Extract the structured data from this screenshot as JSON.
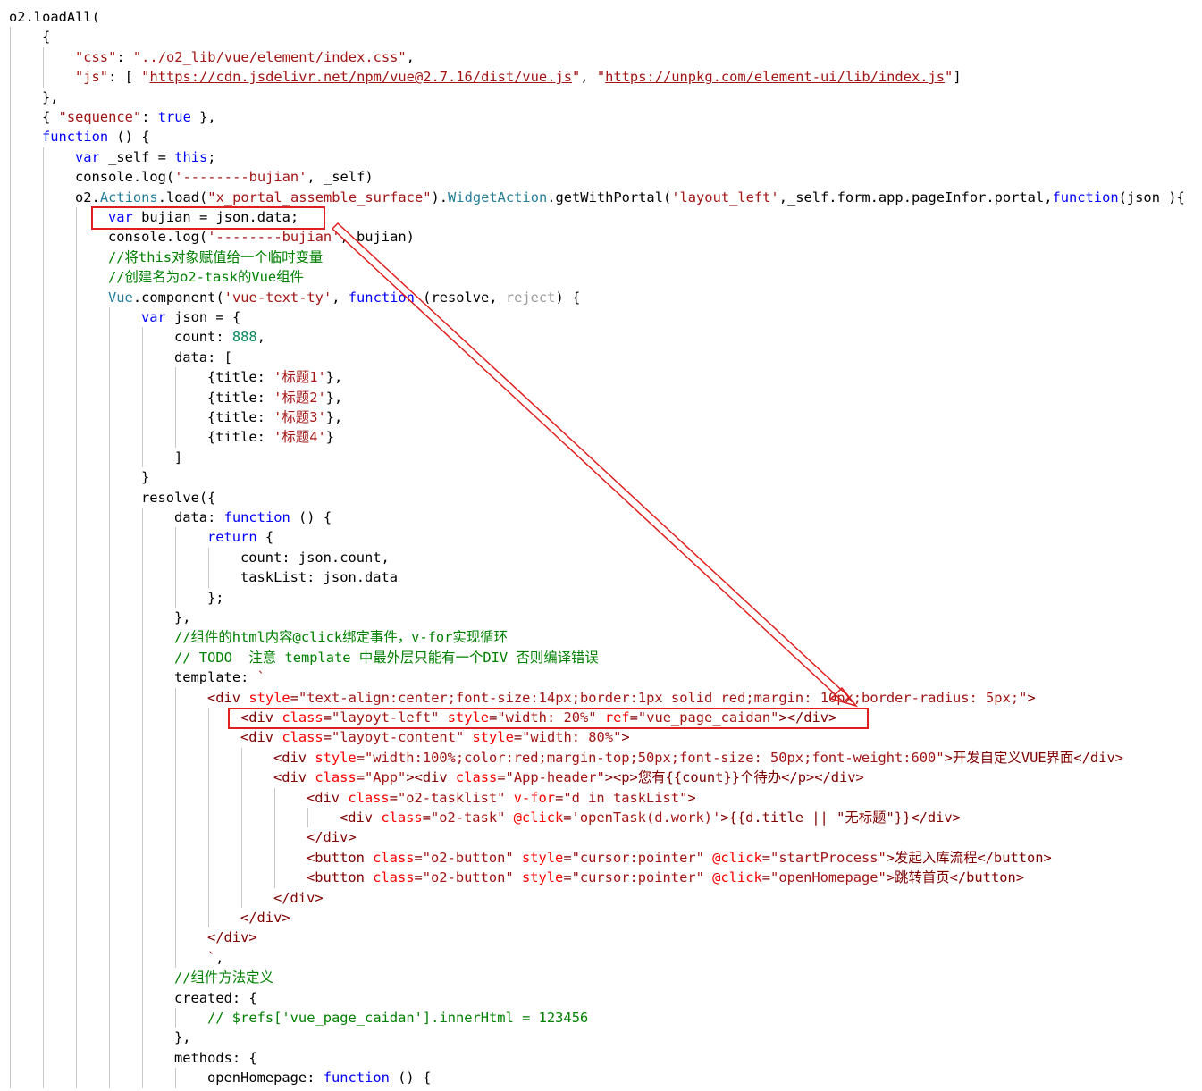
{
  "editor": {
    "lines": [
      {
        "indent": 0,
        "tokens": [
          {
            "c": "t-prop",
            "t": "o2.loadAll("
          }
        ]
      },
      {
        "indent": 1,
        "tokens": [
          {
            "c": "t-prop",
            "t": "{"
          }
        ]
      },
      {
        "indent": 2,
        "tokens": [
          {
            "c": "t-str",
            "t": "\"css\""
          },
          {
            "c": "t-prop",
            "t": ": "
          },
          {
            "c": "t-str",
            "t": "\"../o2_lib/vue/element/index.css\""
          },
          {
            "c": "t-prop",
            "t": ","
          }
        ]
      },
      {
        "indent": 2,
        "tokens": [
          {
            "c": "t-str",
            "t": "\"js\""
          },
          {
            "c": "t-prop",
            "t": ": [ "
          },
          {
            "c": "t-str",
            "t": "\""
          },
          {
            "c": "t-url",
            "t": "https://cdn.jsdelivr.net/npm/vue@2.7.16/dist/vue.js"
          },
          {
            "c": "t-str",
            "t": "\""
          },
          {
            "c": "t-prop",
            "t": ", "
          },
          {
            "c": "t-str",
            "t": "\""
          },
          {
            "c": "t-url",
            "t": "https://unpkg.com/element-ui/lib/index.js"
          },
          {
            "c": "t-str",
            "t": "\""
          },
          {
            "c": "t-prop",
            "t": "]"
          }
        ]
      },
      {
        "indent": 1,
        "tokens": [
          {
            "c": "t-prop",
            "t": "},"
          }
        ]
      },
      {
        "indent": 1,
        "tokens": [
          {
            "c": "t-prop",
            "t": "{ "
          },
          {
            "c": "t-str",
            "t": "\"sequence\""
          },
          {
            "c": "t-prop",
            "t": ": "
          },
          {
            "c": "t-kw",
            "t": "true"
          },
          {
            "c": "t-prop",
            "t": " },"
          }
        ]
      },
      {
        "indent": 1,
        "tokens": [
          {
            "c": "t-kw",
            "t": "function"
          },
          {
            "c": "t-prop",
            "t": " () {"
          }
        ]
      },
      {
        "indent": 2,
        "tokens": [
          {
            "c": "t-kw",
            "t": "var"
          },
          {
            "c": "t-prop",
            "t": " _self = "
          },
          {
            "c": "t-kw",
            "t": "this"
          },
          {
            "c": "t-prop",
            "t": ";"
          }
        ]
      },
      {
        "indent": 2,
        "tokens": [
          {
            "c": "t-prop",
            "t": "console.log("
          },
          {
            "c": "t-str",
            "t": "'--------bujian'"
          },
          {
            "c": "t-prop",
            "t": ", _self)"
          }
        ]
      },
      {
        "indent": 2,
        "tokens": [
          {
            "c": "t-prop",
            "t": "o2."
          },
          {
            "c": "t-obj",
            "t": "Actions"
          },
          {
            "c": "t-prop",
            "t": ".load("
          },
          {
            "c": "t-str",
            "t": "\"x_portal_assemble_surface\""
          },
          {
            "c": "t-prop",
            "t": ")."
          },
          {
            "c": "t-obj",
            "t": "WidgetAction"
          },
          {
            "c": "t-prop",
            "t": ".getWithPortal("
          },
          {
            "c": "t-str",
            "t": "'layout_left'"
          },
          {
            "c": "t-prop",
            "t": ",_self.form.app.pageInfor.portal,"
          },
          {
            "c": "t-kw",
            "t": "function"
          },
          {
            "c": "t-prop",
            "t": "(json ){"
          }
        ]
      },
      {
        "indent": 3,
        "tokens": [
          {
            "c": "t-kw",
            "t": "var"
          },
          {
            "c": "t-prop",
            "t": " bujian = json.data;"
          }
        ]
      },
      {
        "indent": 3,
        "tokens": [
          {
            "c": "t-prop",
            "t": "console.log("
          },
          {
            "c": "t-str",
            "t": "'--------bujian'"
          },
          {
            "c": "t-prop",
            "t": ", bujian)"
          }
        ]
      },
      {
        "indent": 3,
        "tokens": [
          {
            "c": "t-cm",
            "t": "//将this对象赋值给一个临时变量"
          }
        ]
      },
      {
        "indent": 3,
        "tokens": [
          {
            "c": "t-cm",
            "t": "//创建名为o2-task的Vue组件"
          }
        ]
      },
      {
        "indent": 3,
        "tokens": [
          {
            "c": "t-obj",
            "t": "Vue"
          },
          {
            "c": "t-prop",
            "t": ".component("
          },
          {
            "c": "t-str",
            "t": "'vue-text-ty'"
          },
          {
            "c": "t-prop",
            "t": ", "
          },
          {
            "c": "t-kw",
            "t": "function"
          },
          {
            "c": "t-prop",
            "t": " (resolve, "
          },
          {
            "c": "t-param",
            "t": "reject"
          },
          {
            "c": "t-prop",
            "t": ") {"
          }
        ]
      },
      {
        "indent": 4,
        "tokens": [
          {
            "c": "t-kw",
            "t": "var"
          },
          {
            "c": "t-prop",
            "t": " json = {"
          }
        ]
      },
      {
        "indent": 5,
        "tokens": [
          {
            "c": "t-prop",
            "t": "count: "
          },
          {
            "c": "t-num",
            "t": "888"
          },
          {
            "c": "t-prop",
            "t": ","
          }
        ]
      },
      {
        "indent": 5,
        "tokens": [
          {
            "c": "t-prop",
            "t": "data: ["
          }
        ]
      },
      {
        "indent": 6,
        "tokens": [
          {
            "c": "t-prop",
            "t": "{title: "
          },
          {
            "c": "t-str",
            "t": "'标题1'"
          },
          {
            "c": "t-prop",
            "t": "},"
          }
        ]
      },
      {
        "indent": 6,
        "tokens": [
          {
            "c": "t-prop",
            "t": "{title: "
          },
          {
            "c": "t-str",
            "t": "'标题2'"
          },
          {
            "c": "t-prop",
            "t": "},"
          }
        ]
      },
      {
        "indent": 6,
        "tokens": [
          {
            "c": "t-prop",
            "t": "{title: "
          },
          {
            "c": "t-str",
            "t": "'标题3'"
          },
          {
            "c": "t-prop",
            "t": "},"
          }
        ]
      },
      {
        "indent": 6,
        "tokens": [
          {
            "c": "t-prop",
            "t": "{title: "
          },
          {
            "c": "t-str",
            "t": "'标题4'"
          },
          {
            "c": "t-prop",
            "t": "}"
          }
        ]
      },
      {
        "indent": 5,
        "tokens": [
          {
            "c": "t-prop",
            "t": "]"
          }
        ]
      },
      {
        "indent": 4,
        "tokens": [
          {
            "c": "t-prop",
            "t": "}"
          }
        ]
      },
      {
        "indent": 4,
        "tokens": [
          {
            "c": "t-prop",
            "t": "resolve({"
          }
        ]
      },
      {
        "indent": 5,
        "tokens": [
          {
            "c": "t-prop",
            "t": "data: "
          },
          {
            "c": "t-kw",
            "t": "function"
          },
          {
            "c": "t-prop",
            "t": " () {"
          }
        ]
      },
      {
        "indent": 6,
        "tokens": [
          {
            "c": "t-kw",
            "t": "return"
          },
          {
            "c": "t-prop",
            "t": " {"
          }
        ]
      },
      {
        "indent": 7,
        "tokens": [
          {
            "c": "t-prop",
            "t": "count: json.count,"
          }
        ]
      },
      {
        "indent": 7,
        "tokens": [
          {
            "c": "t-prop",
            "t": "taskList: json.data"
          }
        ]
      },
      {
        "indent": 6,
        "tokens": [
          {
            "c": "t-prop",
            "t": "};"
          }
        ]
      },
      {
        "indent": 5,
        "tokens": [
          {
            "c": "t-prop",
            "t": "},"
          }
        ]
      },
      {
        "indent": 5,
        "tokens": [
          {
            "c": "t-cm",
            "t": "//组件的html内容@click绑定事件，v-for实现循环"
          }
        ]
      },
      {
        "indent": 5,
        "tokens": [
          {
            "c": "t-cm",
            "t": "// TODO  注意 template 中最外层只能有一个DIV 否则编译错误"
          }
        ]
      },
      {
        "indent": 5,
        "tokens": [
          {
            "c": "t-prop",
            "t": "template: "
          },
          {
            "c": "t-html",
            "t": "`"
          }
        ]
      },
      {
        "indent": 6,
        "tokens": [
          {
            "c": "t-tag",
            "t": "<div "
          },
          {
            "c": "t-attr",
            "t": "style"
          },
          {
            "c": "t-tag",
            "t": "="
          },
          {
            "c": "t-html",
            "t": "\"text-align:center;font-size:14px;border:1px solid red;margin: 10px;border-radius: 5px;\""
          },
          {
            "c": "t-tag",
            "t": ">"
          }
        ]
      },
      {
        "indent": 7,
        "tokens": [
          {
            "c": "t-tag",
            "t": "<div "
          },
          {
            "c": "t-attr",
            "t": "class"
          },
          {
            "c": "t-tag",
            "t": "="
          },
          {
            "c": "t-html",
            "t": "\"layoyt-left\""
          },
          {
            "c": "t-tag",
            "t": " "
          },
          {
            "c": "t-attr",
            "t": "style"
          },
          {
            "c": "t-tag",
            "t": "="
          },
          {
            "c": "t-html",
            "t": "\"width: 20%\""
          },
          {
            "c": "t-tag",
            "t": " "
          },
          {
            "c": "t-attr",
            "t": "ref"
          },
          {
            "c": "t-tag",
            "t": "="
          },
          {
            "c": "t-html",
            "t": "\"vue_page_caidan\""
          },
          {
            "c": "t-tag",
            "t": "></div>"
          }
        ]
      },
      {
        "indent": 7,
        "tokens": [
          {
            "c": "t-tag",
            "t": "<div "
          },
          {
            "c": "t-attr",
            "t": "class"
          },
          {
            "c": "t-tag",
            "t": "="
          },
          {
            "c": "t-html",
            "t": "\"layoyt-content\""
          },
          {
            "c": "t-tag",
            "t": " "
          },
          {
            "c": "t-attr",
            "t": "style"
          },
          {
            "c": "t-tag",
            "t": "="
          },
          {
            "c": "t-html",
            "t": "\"width: 80%\""
          },
          {
            "c": "t-tag",
            "t": ">"
          }
        ]
      },
      {
        "indent": 8,
        "tokens": [
          {
            "c": "t-tag",
            "t": "<div "
          },
          {
            "c": "t-attr",
            "t": "style"
          },
          {
            "c": "t-tag",
            "t": "="
          },
          {
            "c": "t-html",
            "t": "\"width:100%;color:red;margin-top;50px;font-size: 50px;font-weight:600\""
          },
          {
            "c": "t-tag",
            "t": ">开发自定义VUE界面</div>"
          }
        ]
      },
      {
        "indent": 8,
        "tokens": [
          {
            "c": "t-tag",
            "t": "<div "
          },
          {
            "c": "t-attr",
            "t": "class"
          },
          {
            "c": "t-tag",
            "t": "="
          },
          {
            "c": "t-html",
            "t": "\"App\""
          },
          {
            "c": "t-tag",
            "t": "><div "
          },
          {
            "c": "t-attr",
            "t": "class"
          },
          {
            "c": "t-tag",
            "t": "="
          },
          {
            "c": "t-html",
            "t": "\"App-header\""
          },
          {
            "c": "t-tag",
            "t": "><p>您有{{count}}个待办</p></div>"
          }
        ]
      },
      {
        "indent": 9,
        "tokens": [
          {
            "c": "t-tag",
            "t": "<div "
          },
          {
            "c": "t-attr",
            "t": "class"
          },
          {
            "c": "t-tag",
            "t": "="
          },
          {
            "c": "t-html",
            "t": "\"o2-tasklist\""
          },
          {
            "c": "t-tag",
            "t": " "
          },
          {
            "c": "t-attr",
            "t": "v-for"
          },
          {
            "c": "t-tag",
            "t": "="
          },
          {
            "c": "t-html",
            "t": "\"d in taskList\""
          },
          {
            "c": "t-tag",
            "t": ">"
          }
        ]
      },
      {
        "indent": 10,
        "tokens": [
          {
            "c": "t-tag",
            "t": "<div "
          },
          {
            "c": "t-attr",
            "t": "class"
          },
          {
            "c": "t-tag",
            "t": "="
          },
          {
            "c": "t-html",
            "t": "\"o2-task\""
          },
          {
            "c": "t-tag",
            "t": " "
          },
          {
            "c": "t-attr",
            "t": "@click"
          },
          {
            "c": "t-tag",
            "t": "="
          },
          {
            "c": "t-html",
            "t": "'openTask(d.work)'"
          },
          {
            "c": "t-tag",
            "t": ">{{d.title || \"无标题\"}}</div>"
          }
        ]
      },
      {
        "indent": 9,
        "tokens": [
          {
            "c": "t-tag",
            "t": "</div>"
          }
        ]
      },
      {
        "indent": 9,
        "tokens": [
          {
            "c": "t-tag",
            "t": "<button "
          },
          {
            "c": "t-attr",
            "t": "class"
          },
          {
            "c": "t-tag",
            "t": "="
          },
          {
            "c": "t-html",
            "t": "\"o2-button\""
          },
          {
            "c": "t-tag",
            "t": " "
          },
          {
            "c": "t-attr",
            "t": "style"
          },
          {
            "c": "t-tag",
            "t": "="
          },
          {
            "c": "t-html",
            "t": "\"cursor:pointer\""
          },
          {
            "c": "t-tag",
            "t": " "
          },
          {
            "c": "t-attr",
            "t": "@click"
          },
          {
            "c": "t-tag",
            "t": "="
          },
          {
            "c": "t-html",
            "t": "\"startProcess\""
          },
          {
            "c": "t-tag",
            "t": ">发起入库流程</button>"
          }
        ]
      },
      {
        "indent": 9,
        "tokens": [
          {
            "c": "t-tag",
            "t": "<button "
          },
          {
            "c": "t-attr",
            "t": "class"
          },
          {
            "c": "t-tag",
            "t": "="
          },
          {
            "c": "t-html",
            "t": "\"o2-button\""
          },
          {
            "c": "t-tag",
            "t": " "
          },
          {
            "c": "t-attr",
            "t": "style"
          },
          {
            "c": "t-tag",
            "t": "="
          },
          {
            "c": "t-html",
            "t": "\"cursor:pointer\""
          },
          {
            "c": "t-tag",
            "t": " "
          },
          {
            "c": "t-attr",
            "t": "@click"
          },
          {
            "c": "t-tag",
            "t": "="
          },
          {
            "c": "t-html",
            "t": "\"openHomepage\""
          },
          {
            "c": "t-tag",
            "t": ">跳转首页</button>"
          }
        ]
      },
      {
        "indent": 8,
        "tokens": [
          {
            "c": "t-tag",
            "t": "</div>"
          }
        ]
      },
      {
        "indent": 7,
        "tokens": [
          {
            "c": "t-tag",
            "t": "</div>"
          }
        ]
      },
      {
        "indent": 6,
        "tokens": [
          {
            "c": "t-tag",
            "t": "</div>"
          }
        ]
      },
      {
        "indent": 6,
        "tokens": [
          {
            "c": "t-html",
            "t": "`"
          },
          {
            "c": "t-prop",
            "t": ","
          }
        ]
      },
      {
        "indent": 5,
        "tokens": [
          {
            "c": "t-cm",
            "t": "//组件方法定义"
          }
        ]
      },
      {
        "indent": 5,
        "tokens": [
          {
            "c": "t-prop",
            "t": "created: {"
          }
        ]
      },
      {
        "indent": 6,
        "tokens": [
          {
            "c": "t-cm",
            "t": "// $refs['vue_page_caidan'].innerHtml = 123456"
          }
        ]
      },
      {
        "indent": 5,
        "tokens": [
          {
            "c": "t-prop",
            "t": "},"
          }
        ]
      },
      {
        "indent": 5,
        "tokens": [
          {
            "c": "t-prop",
            "t": "methods: {"
          }
        ]
      },
      {
        "indent": 6,
        "tokens": [
          {
            "c": "t-prop",
            "t": "openHomepage: "
          },
          {
            "c": "t-kw",
            "t": "function"
          },
          {
            "c": "t-prop",
            "t": " () {"
          }
        ]
      }
    ]
  },
  "colors": {
    "highlight": "#e02020",
    "guide": "#c9c9c9"
  }
}
